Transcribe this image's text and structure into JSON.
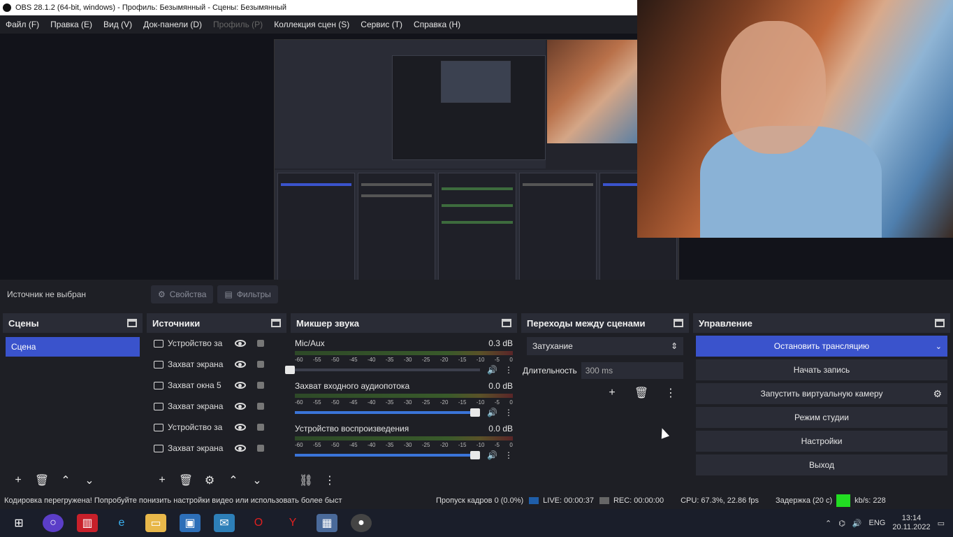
{
  "window": {
    "title": "OBS 28.1.2 (64-bit, windows) - Профиль: Безымянный - Сцены: Безымянный"
  },
  "menu": [
    {
      "label": "Файл (F)",
      "enabled": true
    },
    {
      "label": "Правка (E)",
      "enabled": true
    },
    {
      "label": "Вид (V)",
      "enabled": true
    },
    {
      "label": "Док-панели (D)",
      "enabled": true
    },
    {
      "label": "Профиль (P)",
      "enabled": false
    },
    {
      "label": "Коллекция сцен (S)",
      "enabled": true
    },
    {
      "label": "Сервис (T)",
      "enabled": true
    },
    {
      "label": "Справка (H)",
      "enabled": true
    }
  ],
  "source_toolbar": {
    "label": "Источник не выбран",
    "properties": "Свойства",
    "filters": "Фильтры"
  },
  "scenes": {
    "title": "Сцены",
    "items": [
      "Сцена"
    ]
  },
  "sources": {
    "title": "Источники",
    "items": [
      {
        "name": "Устройство за",
        "icon": "camera-icon"
      },
      {
        "name": "Захват экрана",
        "icon": "monitor-icon"
      },
      {
        "name": "Захват окна 5",
        "icon": "window-icon"
      },
      {
        "name": "Захват экрана",
        "icon": "monitor-icon"
      },
      {
        "name": "Устройство за",
        "icon": "camera-icon"
      },
      {
        "name": "Захват экрана",
        "icon": "monitor-icon"
      }
    ]
  },
  "mixer": {
    "title": "Микшер звука",
    "ticks": [
      "-60",
      "-55",
      "-50",
      "-45",
      "-40",
      "-35",
      "-30",
      "-25",
      "-20",
      "-15",
      "-10",
      "-5",
      "0"
    ],
    "channels": [
      {
        "name": "Mic/Aux",
        "level": "0.3 dB",
        "volume": 0
      },
      {
        "name": "Захват входного аудиопотока",
        "level": "0.0 dB",
        "volume": 1.0
      },
      {
        "name": "Устройство воспроизведения",
        "level": "0.0 dB",
        "volume": 1.0
      }
    ]
  },
  "transitions": {
    "title": "Переходы между сценами",
    "selected": "Затухание",
    "duration_label": "Длительность",
    "duration_value": "300 ms"
  },
  "controls": {
    "title": "Управление",
    "buttons": {
      "stream": "Остановить трансляцию",
      "record": "Начать запись",
      "virtualcam": "Запустить виртуальную камеру",
      "studio": "Режим студии",
      "settings": "Настройки",
      "exit": "Выход"
    }
  },
  "status": {
    "message": "Кодировка перегружена! Попробуйте понизить настройки видео или использовать более быст",
    "dropped": "Пропуск кадров 0 (0.0%)",
    "live": "LIVE: 00:00:37",
    "rec": "REC: 00:00:00",
    "cpu": "CPU: 67.3%, 22.86 fps",
    "delay": "Задержка (20 с)",
    "kbps": "kb/s: 228"
  },
  "taskbar": {
    "lang": "ENG",
    "time": "13:14",
    "date": "20.11.2022"
  },
  "colors": {
    "accent": "#3a53cc",
    "panel": "#2a2c36",
    "background": "#1e1f25",
    "live_green": "#22dd22"
  }
}
